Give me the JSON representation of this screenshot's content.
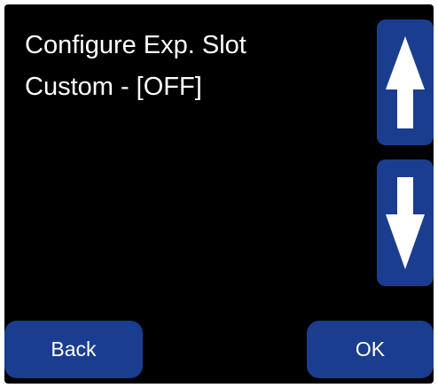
{
  "display": {
    "lines": [
      "Configure Exp. Slot",
      "Custom - [OFF]"
    ]
  },
  "buttons": {
    "up_icon": "arrow-up-icon",
    "down_icon": "arrow-down-icon",
    "back_label": "Back",
    "ok_label": "OK"
  },
  "colors": {
    "background": "#000000",
    "button": "#1a3d8f",
    "text": "#ffffff"
  }
}
